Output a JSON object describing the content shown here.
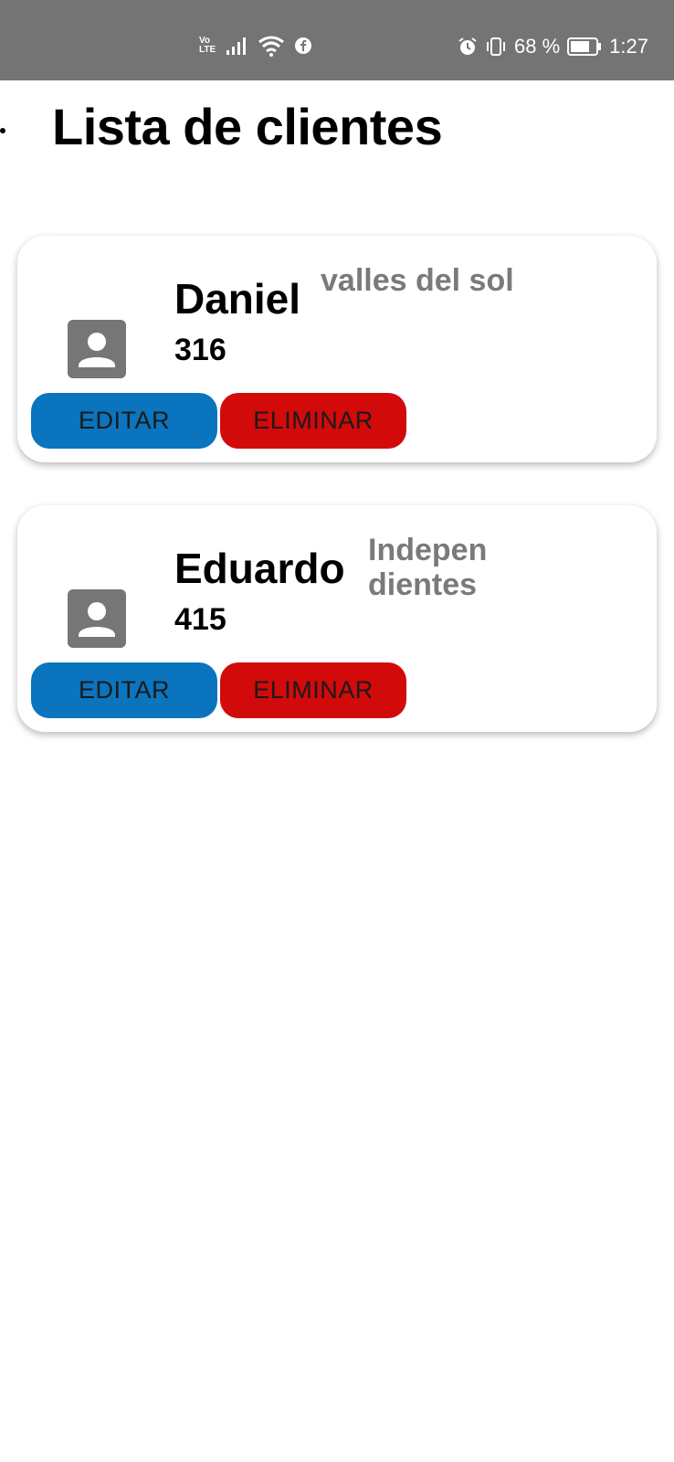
{
  "status_bar": {
    "volte_top": "Vo",
    "volte_bottom": "LTE",
    "battery": "68 %",
    "time": "1:27",
    "icons": [
      "signal-icon",
      "wifi-icon",
      "facebook-icon",
      "alarm-icon",
      "vibrate-icon",
      "battery-icon"
    ]
  },
  "page": {
    "title": "Lista de clientes"
  },
  "clients": [
    {
      "name": "Daniel",
      "address": "valles del sol",
      "number": "316",
      "edit_label": "EDITAR",
      "delete_label": "ELIMINAR"
    },
    {
      "name": "Eduardo",
      "address": "Independientes",
      "number": "415",
      "edit_label": "EDITAR",
      "delete_label": "ELIMINAR"
    }
  ],
  "colors": {
    "status_bar": "#747474",
    "edit_button": "#0a74be",
    "delete_button": "#d20a0a",
    "avatar": "#767676",
    "address_text": "#7a7a7a"
  }
}
